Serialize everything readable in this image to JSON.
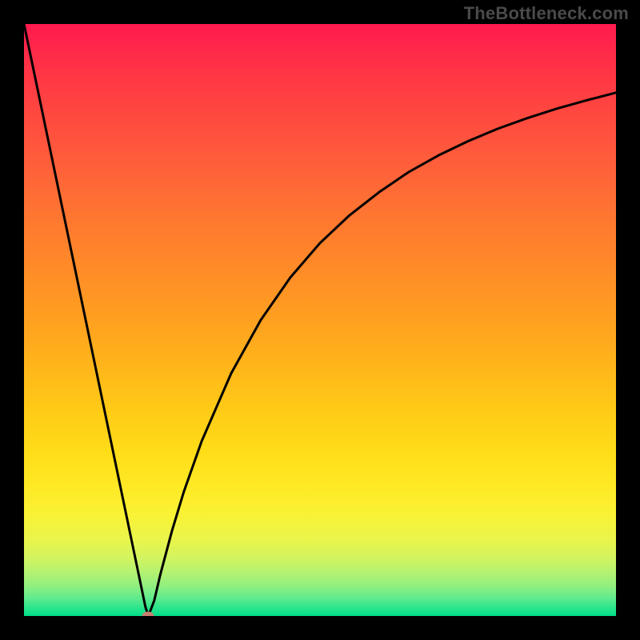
{
  "watermark": "TheBottleneck.com",
  "chart_data": {
    "type": "line",
    "title": "",
    "xlabel": "",
    "ylabel": "",
    "xlim": [
      0,
      100
    ],
    "ylim": [
      0,
      100
    ],
    "series": [
      {
        "name": "bottleneck-curve",
        "x": [
          0,
          5,
          10,
          15,
          17,
          19,
          20,
          20.5,
          21,
          21.5,
          22,
          23,
          25,
          27,
          30,
          35,
          40,
          45,
          50,
          55,
          60,
          65,
          70,
          75,
          80,
          85,
          90,
          95,
          100
        ],
        "values": [
          100,
          76,
          52,
          28,
          18.4,
          8.8,
          4.0,
          1.6,
          0.0,
          1.3,
          2.6,
          6.9,
          14.4,
          21.0,
          29.5,
          41.0,
          50.0,
          57.2,
          63.0,
          67.7,
          71.6,
          75.0,
          77.8,
          80.2,
          82.3,
          84.1,
          85.7,
          87.1,
          88.4
        ]
      }
    ],
    "annotations": [
      {
        "name": "optimal-point",
        "x": 21,
        "y": 0
      }
    ],
    "gradient_stops": [
      {
        "pos": 0,
        "color": "#ff1a4f"
      },
      {
        "pos": 50,
        "color": "#ffa020"
      },
      {
        "pos": 80,
        "color": "#f9f236"
      },
      {
        "pos": 100,
        "color": "#00de87"
      }
    ]
  }
}
